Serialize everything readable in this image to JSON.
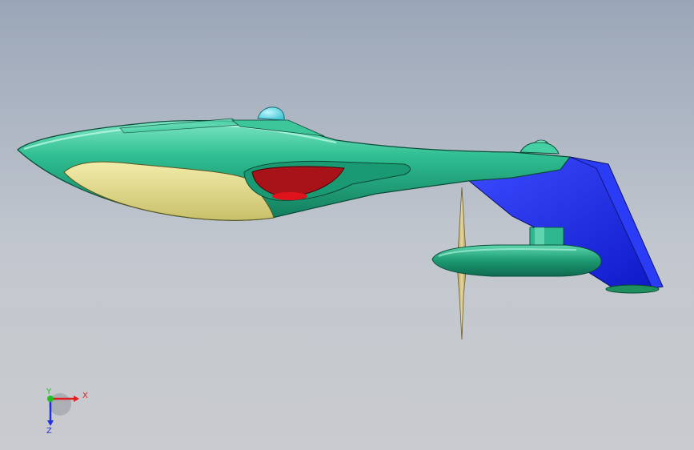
{
  "viewport": {
    "colors": {
      "background_top": "#9aa6b8",
      "background_bottom": "#c9cbce",
      "fuselage": "#1faa7f",
      "fuselage_highlight": "#6fe0bd",
      "canopy": "#56d6e0",
      "nose_underside": "#e4de8a",
      "intake_red": "#c8141a",
      "wing_blue": "#1b2cf0",
      "propeller": "#c9b87a"
    },
    "model_parts": [
      "fuselage",
      "canopy",
      "nose-underside-panel",
      "air-intake",
      "tail-fin",
      "wing",
      "engine-nacelle",
      "propeller"
    ]
  },
  "triad": {
    "x_label": "X",
    "y_label": "Y",
    "z_label": "Z",
    "x_color": "#e02020",
    "y_color": "#20c020",
    "z_color": "#2030e0"
  }
}
